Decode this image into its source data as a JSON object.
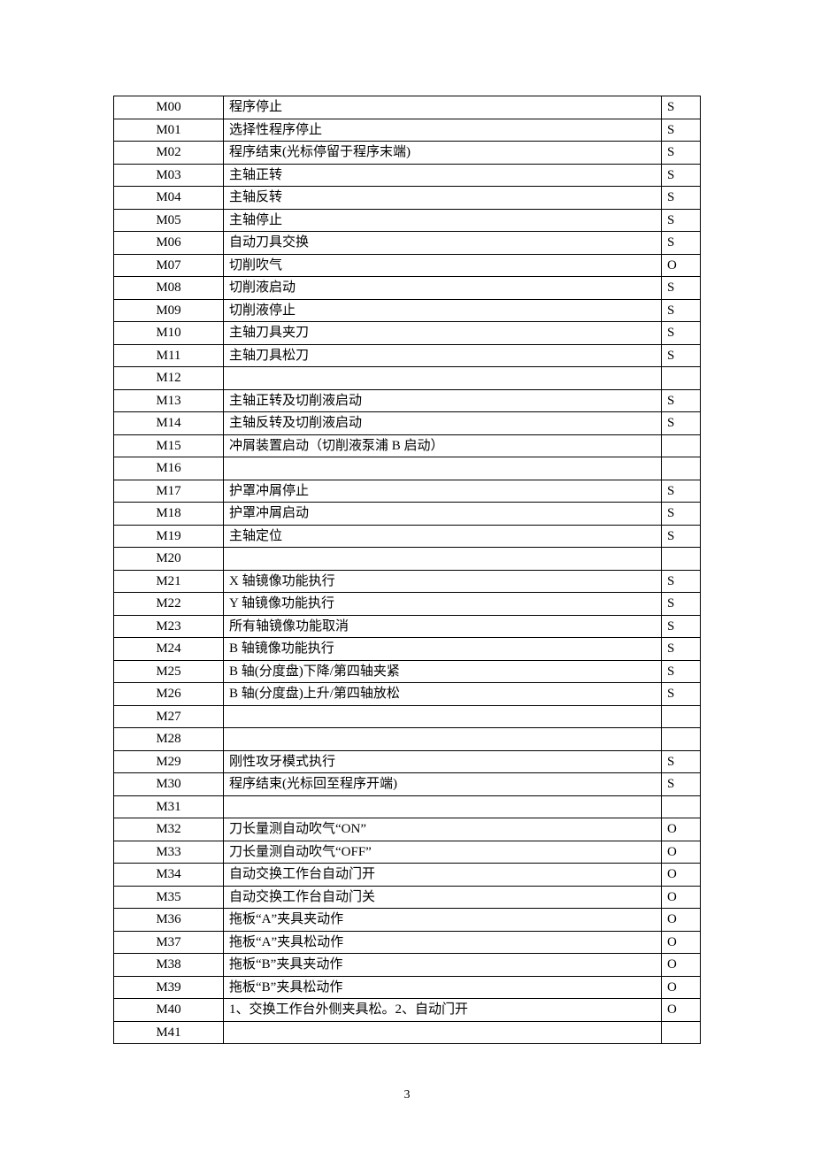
{
  "page_number": "3",
  "rows": [
    {
      "code": "M00",
      "desc": "程序停止",
      "type": "S"
    },
    {
      "code": "M01",
      "desc": "选择性程序停止",
      "type": "S"
    },
    {
      "code": "M02",
      "desc": "程序结束(光标停留于程序末端)",
      "type": "S"
    },
    {
      "code": "M03",
      "desc": "主轴正转",
      "type": "S"
    },
    {
      "code": "M04",
      "desc": "主轴反转",
      "type": "S"
    },
    {
      "code": "M05",
      "desc": "主轴停止",
      "type": "S"
    },
    {
      "code": "M06",
      "desc": "自动刀具交换",
      "type": "S"
    },
    {
      "code": "M07",
      "desc": "切削吹气",
      "type": "O"
    },
    {
      "code": "M08",
      "desc": "切削液启动",
      "type": "S"
    },
    {
      "code": "M09",
      "desc": "切削液停止",
      "type": "S"
    },
    {
      "code": "M10",
      "desc": "主轴刀具夹刀",
      "type": "S"
    },
    {
      "code": "M11",
      "desc": "主轴刀具松刀",
      "type": "S"
    },
    {
      "code": "M12",
      "desc": "",
      "type": ""
    },
    {
      "code": "M13",
      "desc": "主轴正转及切削液启动",
      "type": "S"
    },
    {
      "code": "M14",
      "desc": "主轴反转及切削液启动",
      "type": "S"
    },
    {
      "code": "M15",
      "desc": "冲屑装置启动（切削液泵浦 B 启动）",
      "type": ""
    },
    {
      "code": "M16",
      "desc": "",
      "type": ""
    },
    {
      "code": "M17",
      "desc": "护罩冲屑停止",
      "type": "S"
    },
    {
      "code": "M18",
      "desc": "护罩冲屑启动",
      "type": "S"
    },
    {
      "code": "M19",
      "desc": "主轴定位",
      "type": "S"
    },
    {
      "code": "M20",
      "desc": "",
      "type": ""
    },
    {
      "code": "M21",
      "desc": "X 轴镜像功能执行",
      "type": "S"
    },
    {
      "code": "M22",
      "desc": "Y 轴镜像功能执行",
      "type": "S"
    },
    {
      "code": "M23",
      "desc": "所有轴镜像功能取消",
      "type": "S"
    },
    {
      "code": "M24",
      "desc": "B 轴镜像功能执行",
      "type": "S"
    },
    {
      "code": "M25",
      "desc": "B 轴(分度盘)下降/第四轴夹紧",
      "type": "S"
    },
    {
      "code": "M26",
      "desc": "B 轴(分度盘)上升/第四轴放松",
      "type": "S"
    },
    {
      "code": "M27",
      "desc": "",
      "type": ""
    },
    {
      "code": "M28",
      "desc": "",
      "type": ""
    },
    {
      "code": "M29",
      "desc": "刚性攻牙模式执行",
      "type": "S"
    },
    {
      "code": "M30",
      "desc": "程序结束(光标回至程序开端)",
      "type": "S"
    },
    {
      "code": "M31",
      "desc": "",
      "type": ""
    },
    {
      "code": "M32",
      "desc": "刀长量测自动吹气“ON”",
      "type": "O"
    },
    {
      "code": "M33",
      "desc": "刀长量测自动吹气“OFF”",
      "type": "O"
    },
    {
      "code": "M34",
      "desc": "自动交换工作台自动门开",
      "type": "O"
    },
    {
      "code": "M35",
      "desc": "自动交换工作台自动门关",
      "type": "O"
    },
    {
      "code": "M36",
      "desc": "拖板“A”夹具夹动作",
      "type": "O"
    },
    {
      "code": "M37",
      "desc": "拖板“A”夹具松动作",
      "type": "O"
    },
    {
      "code": "M38",
      "desc": "拖板“B”夹具夹动作",
      "type": "O"
    },
    {
      "code": "M39",
      "desc": "拖板“B”夹具松动作",
      "type": "O"
    },
    {
      "code": "M40",
      "desc": "1、交换工作台外侧夹具松。2、自动门开",
      "type": "O"
    },
    {
      "code": "M41",
      "desc": "",
      "type": ""
    }
  ]
}
